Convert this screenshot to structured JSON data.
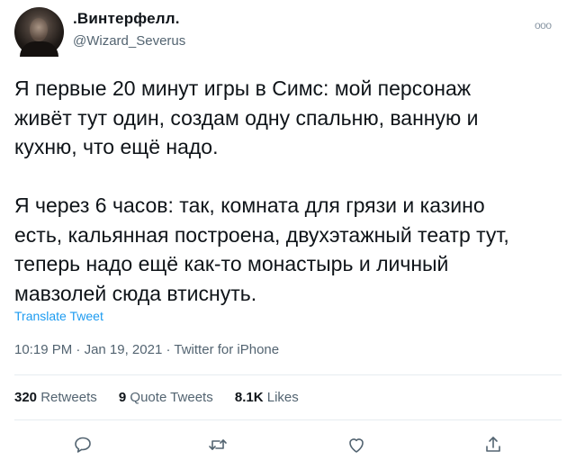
{
  "tweet": {
    "author": {
      "display_name": ".Винтерфелл.",
      "handle": "@Wizard_Severus"
    },
    "text": "Я первые 20 минут игры в Симс: мой персонаж\nживёт тут один, создам одну спальню, ванную и\nкухню, что ещё надо.\n\nЯ через 6 часов: так, комната для грязи и казино\nесть, кальянная построена, двухэтажный театр тут,\nтеперь надо ещё как-то монастырь и личный\nмавзолей сюда втиснуть.",
    "translate_label": "Translate Tweet",
    "time": "10:19 PM",
    "separator": "·",
    "date": "Jan 19, 2021",
    "source": "Twitter for iPhone"
  },
  "stats": {
    "retweets_count": "320",
    "retweets_label": "Retweets",
    "quotes_count": "9",
    "quotes_label": "Quote Tweets",
    "likes_count": "8.1K",
    "likes_label": "Likes"
  },
  "icons": {
    "more": "more-options-icon",
    "reply": "reply-icon",
    "retweet": "retweet-icon",
    "like": "like-icon",
    "share": "share-icon"
  },
  "colors": {
    "accent": "#1d9bf0",
    "secondary_text": "#536471",
    "primary_text": "#0f1419",
    "icon": "#536471"
  }
}
